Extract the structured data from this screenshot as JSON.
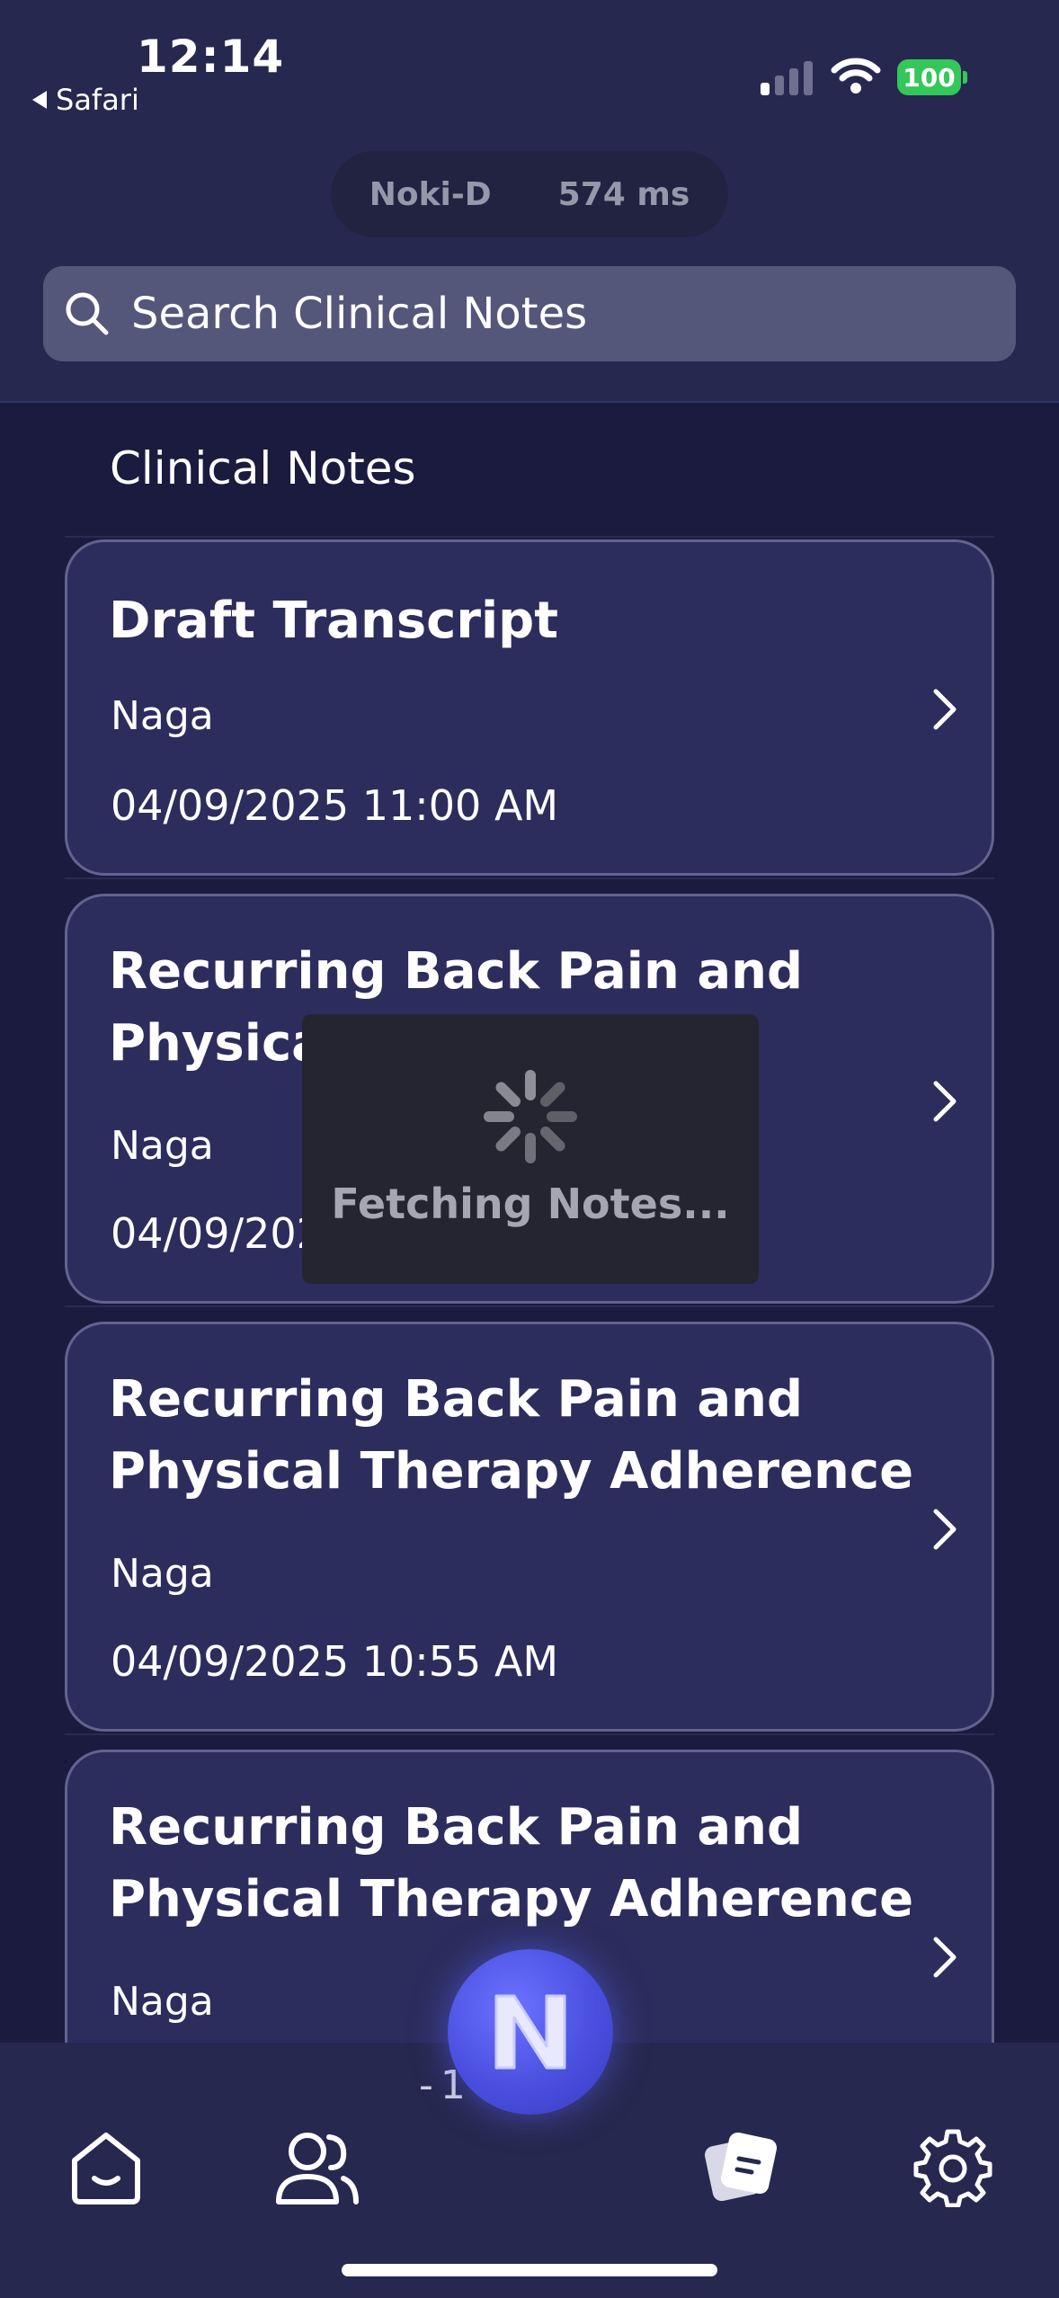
{
  "status_bar": {
    "time": "12:14",
    "back_app": "Safari",
    "battery": "100"
  },
  "debug_pill": {
    "device": "Noki-D",
    "latency": "574 ms"
  },
  "search": {
    "placeholder": "Search Clinical Notes"
  },
  "section_title": "Clinical Notes",
  "notes": [
    {
      "title": "Draft Transcript",
      "author": "Naga",
      "date": "04/09/2025 11:00 AM"
    },
    {
      "title": "Recurring Back Pain and Physical Therapy",
      "author": "Naga",
      "date": "04/09/202"
    },
    {
      "title": "Recurring Back Pain and Physical Therapy Adherence",
      "author": "Naga",
      "date": "04/09/2025 10:55 AM"
    },
    {
      "title": "Recurring Back Pain and Physical Therapy Adherence",
      "author": "Naga",
      "date": ""
    }
  ],
  "loading": {
    "label": "Fetching Notes..."
  },
  "bottom_nav": {
    "ghost_time": "-1 AM",
    "items": [
      {
        "icon": "home-icon"
      },
      {
        "icon": "patients-icon"
      },
      {
        "icon": "notes-icon"
      },
      {
        "icon": "settings-icon"
      }
    ]
  },
  "fab": {
    "icon": "noki-logo-icon"
  },
  "colors": {
    "background": "#1b1b40",
    "header": "#27284f",
    "card": "#2c2d5d",
    "card_border": "#62648f",
    "search": "#54567a",
    "accent": "#4a4fe0",
    "battery": "#34c759"
  }
}
